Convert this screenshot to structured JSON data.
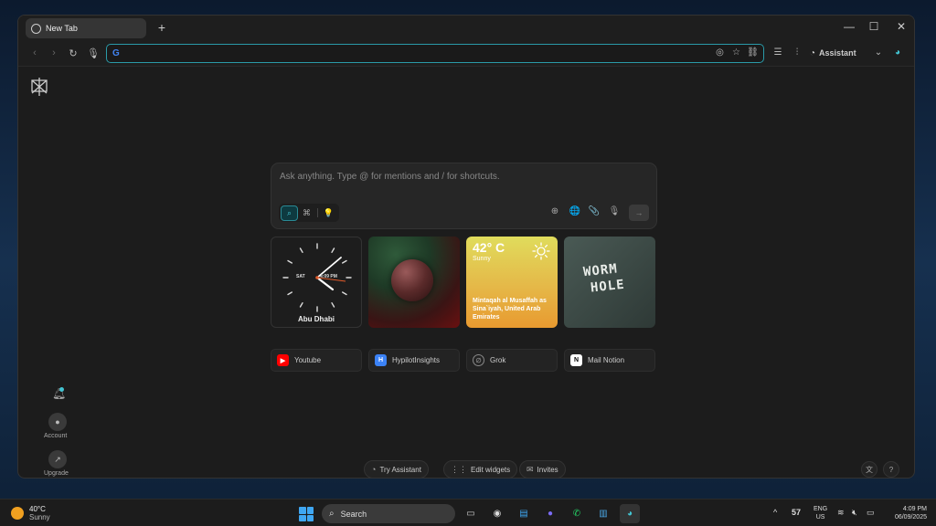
{
  "browser": {
    "tab_title": "New Tab",
    "address_value": "",
    "assistant_label": "Assistant"
  },
  "search": {
    "placeholder": "Ask anything. Type @ for mentions and / for shortcuts."
  },
  "widgets": {
    "clock": {
      "city": "Abu Dhabi",
      "day": "SAT",
      "time": "4:09 PM"
    },
    "weather": {
      "temp": "42° C",
      "condition": "Sunny",
      "location": "Mintaqah al Musaffah as Sina`iyah, United Arab Emirates"
    },
    "wormhole_text": [
      "WORM",
      "HOLE"
    ]
  },
  "shortcuts": [
    {
      "label": "Youtube",
      "icon": "youtube-icon",
      "color": "#ff0000"
    },
    {
      "label": "HypilotInsights",
      "icon": "hypilot-icon",
      "color": "#3b82f6"
    },
    {
      "label": "Grok",
      "icon": "grok-icon",
      "color": "#888888"
    },
    {
      "label": "Mail Notion",
      "icon": "notion-icon",
      "color": "#ffffff"
    }
  ],
  "sidebar": {
    "account_label": "Account",
    "upgrade_label": "Upgrade"
  },
  "bottom_bar": {
    "try_assistant": "Try Assistant",
    "edit_widgets": "Edit widgets",
    "invites": "Invites"
  },
  "taskbar": {
    "weather_temp": "40°C",
    "weather_cond": "Sunny",
    "search_label": "Search",
    "tray_count": "57",
    "lang_top": "ENG",
    "lang_bottom": "US",
    "time": "4:09 PM",
    "date": "06/09/2025"
  },
  "colors": {
    "accent": "#43c4d2",
    "weather_top": "#e0dc5c",
    "weather_bottom": "#e89a30"
  }
}
